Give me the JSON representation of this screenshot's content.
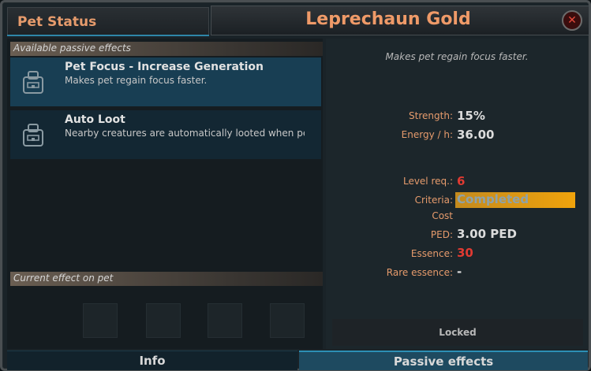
{
  "left_header": {
    "title": "Pet Status"
  },
  "right_header": {
    "title": "Leprechaun Gold",
    "close_symbol": "✕"
  },
  "left_panel": {
    "available_section_label": "Available passive effects",
    "effects": [
      {
        "name": "Pet Focus - Increase Generation",
        "description": "Makes pet regain focus faster.",
        "icon": "pet-slot-icon",
        "selected": true
      },
      {
        "name": "Auto Loot",
        "description": "Nearby creatures are automatically looted when pe",
        "icon": "pet-slot-icon",
        "selected": false
      }
    ],
    "current_section_label": "Current effect on pet",
    "slot_count": 4
  },
  "right_panel": {
    "description": "Makes pet regain focus faster.",
    "strength_label": "Strength:",
    "strength_value": "15%",
    "energy_label": "Energy / h:",
    "energy_value": "36.00",
    "level_label": "Level req.:",
    "level_value": "6",
    "criteria_label": "Criteria:",
    "criteria_value": "Completed",
    "cost_label": "Cost",
    "ped_label": "PED:",
    "ped_value": "3.00 PED",
    "essence_label": "Essence:",
    "essence_value": "30",
    "rare_essence_label": "Rare essence:",
    "rare_essence_value": "-",
    "locked_label": "Locked"
  },
  "tabs": {
    "info": "Info",
    "passive": "Passive effects",
    "active": "passive"
  },
  "colors": {
    "title_orange": "#ef9a68",
    "label_orange": "#e69b6c",
    "value_red": "#e03a32",
    "criteria_gold": "#f0a30c",
    "accent_blue": "#2e86a8"
  }
}
